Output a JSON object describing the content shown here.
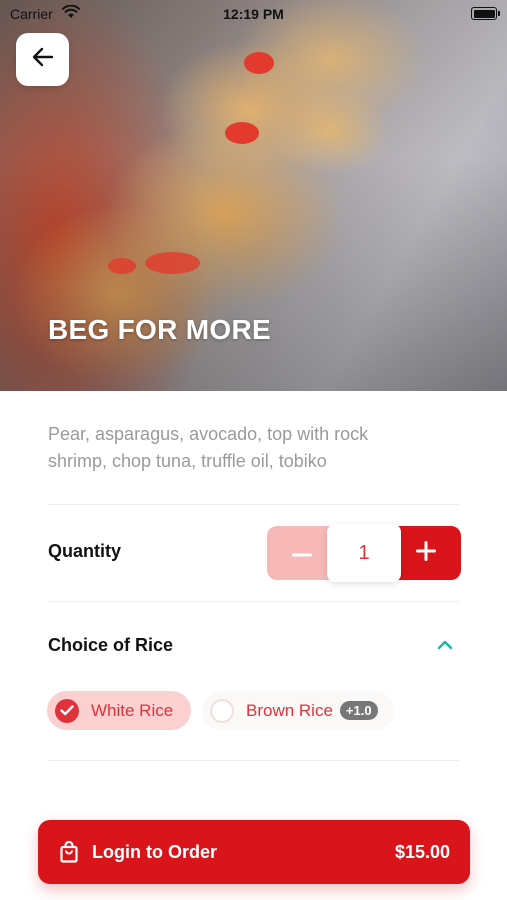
{
  "status_bar": {
    "carrier": "Carrier",
    "time": "12:19 PM"
  },
  "hero": {
    "title": "BEG FOR MORE",
    "image_icon": "sushi-roll-photo"
  },
  "description": "Pear, asparagus, avocado, top with rock shrimp, chop tuna, truffle oil, tobiko",
  "quantity": {
    "label": "Quantity",
    "value": "1",
    "minus_icon": "minus-icon",
    "plus_icon": "plus-icon"
  },
  "rice": {
    "label": "Choice of Rice",
    "expanded": true,
    "options": [
      {
        "label": "White Rice",
        "selected": true,
        "extra": ""
      },
      {
        "label": "Brown Rice",
        "selected": false,
        "extra": "+1.0"
      }
    ]
  },
  "order_button": {
    "label": "Login to Order",
    "price": "$15.00",
    "icon": "shopping-bag-icon"
  },
  "colors": {
    "accent": "#d9141a",
    "accent_light": "#fbd0d0",
    "stepper_disabled": "#f7b8b8",
    "chevron": "#19b3a8",
    "description_text": "#9a9a9a"
  }
}
